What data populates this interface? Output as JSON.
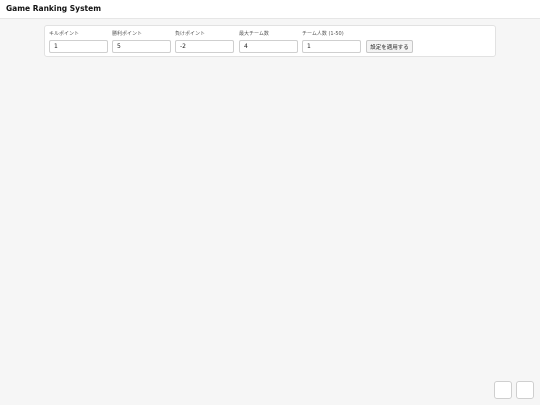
{
  "header": {
    "title": "Game Ranking System"
  },
  "settings": {
    "fields": [
      {
        "label": "キルポイント",
        "value": "1"
      },
      {
        "label": "勝利ポイント",
        "value": "5"
      },
      {
        "label": "負けポイント",
        "value": "-2"
      },
      {
        "label": "最大チーム数",
        "value": "4"
      },
      {
        "label": "チーム人数 (1-50)",
        "value": "1"
      }
    ],
    "apply_label": "設定を適用する"
  }
}
